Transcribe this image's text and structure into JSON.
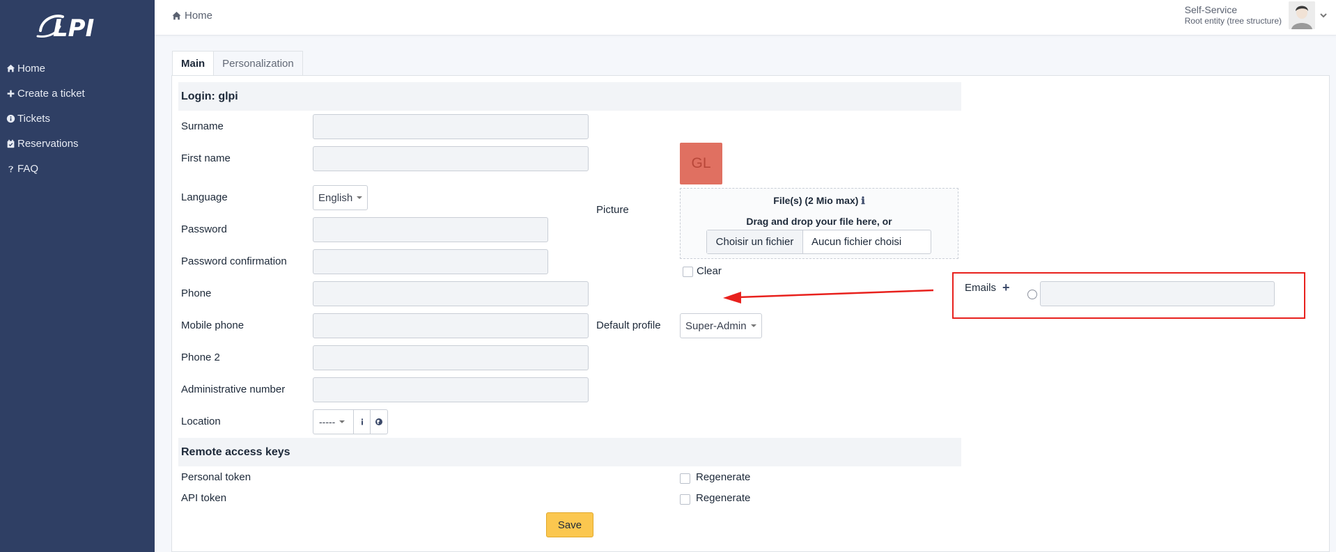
{
  "sidebar": {
    "logo_text": "GLPI",
    "items": [
      {
        "label": "Home",
        "icon": "home-icon"
      },
      {
        "label": "Create a ticket",
        "icon": "plus-icon"
      },
      {
        "label": "Tickets",
        "icon": "info-circle-icon"
      },
      {
        "label": "Reservations",
        "icon": "calendar-check-icon"
      },
      {
        "label": "FAQ",
        "icon": "question-icon"
      }
    ]
  },
  "header": {
    "breadcrumb": "Home",
    "profile": "Self-Service",
    "entity": "Root entity (tree structure)"
  },
  "tabs": [
    {
      "label": "Main",
      "active": true
    },
    {
      "label": "Personalization",
      "active": false
    }
  ],
  "form": {
    "login_header": "Login: glpi",
    "surname_label": "Surname",
    "surname_value": "",
    "firstname_label": "First name",
    "firstname_value": "",
    "language_label": "Language",
    "language_value": "English",
    "password_label": "Password",
    "password_confirm_label": "Password confirmation",
    "phone_label": "Phone",
    "mobile_label": "Mobile phone",
    "phone2_label": "Phone 2",
    "admin_number_label": "Administrative number",
    "location_label": "Location",
    "location_value": "-----",
    "picture_label": "Picture",
    "picture_initials": "GL",
    "dropzone_title": "File(s) (2 Mio max)",
    "dropzone_sub": "Drag and drop your file here, or",
    "file_button": "Choisir un fichier",
    "file_none": "Aucun fichier choisi",
    "clear_label": "Clear",
    "default_profile_label": "Default profile",
    "default_profile_value": "Super-Admin",
    "emails_label": "Emails",
    "remote_header": "Remote access keys",
    "personal_token_label": "Personal token",
    "api_token_label": "API token",
    "regenerate_label": "Regenerate",
    "save_label": "Save"
  },
  "colors": {
    "sidebar_bg": "#2f3f64",
    "save_button": "#fbc74f",
    "highlight_box": "#e8211d",
    "avatar_bg": "#e07061"
  }
}
